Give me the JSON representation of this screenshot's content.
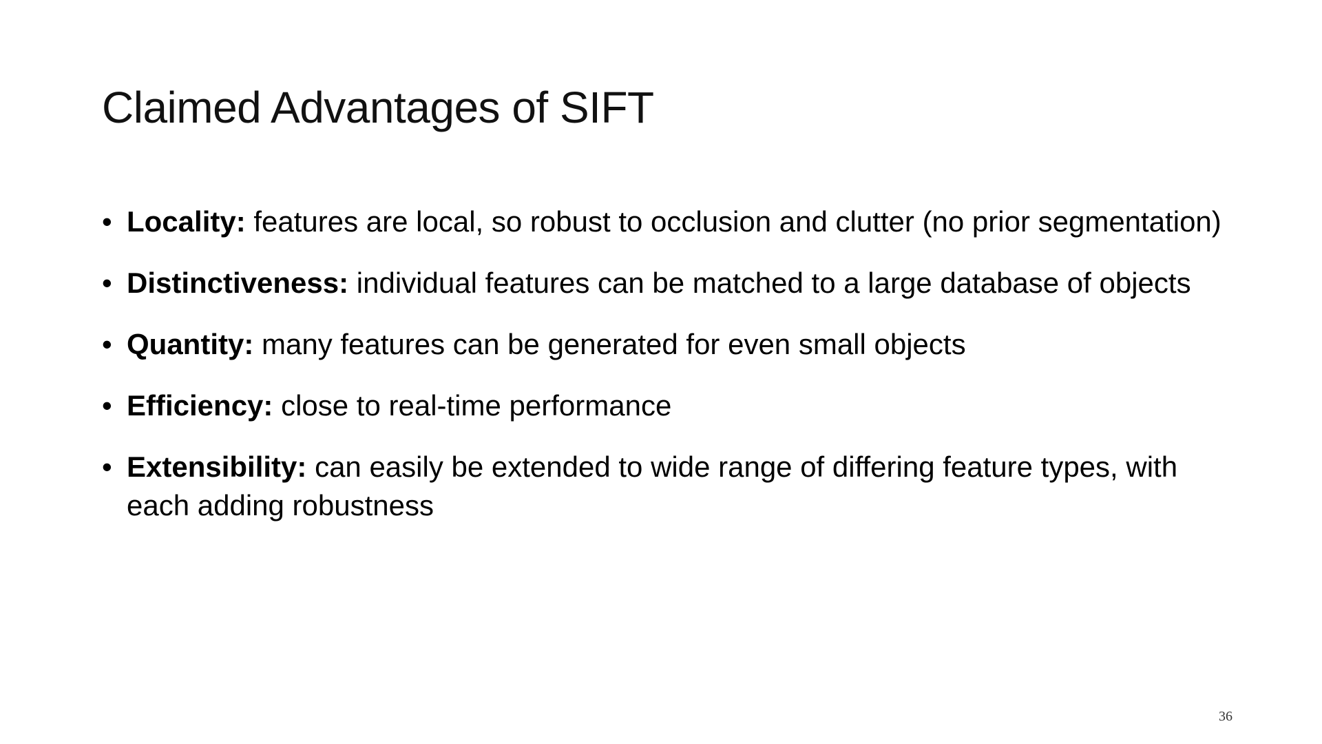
{
  "slide": {
    "title": "Claimed Advantages of SIFT",
    "bullet_glyph": "•",
    "bullets": [
      {
        "term": "Locality:",
        "text": "features are local, so robust to occlusion and clutter (no prior segmentation)"
      },
      {
        "term": "Distinctiveness:",
        "text": "individual features can be matched to a large database of objects"
      },
      {
        "term": "Quantity:",
        "text": "many features can be generated for even small objects"
      },
      {
        "term": "Efficiency:",
        "text": "close to real-time performance"
      },
      {
        "term": "Extensibility:",
        "text": "can easily be extended to wide range of differing feature types, with each adding robustness"
      }
    ],
    "page_number": "36"
  }
}
